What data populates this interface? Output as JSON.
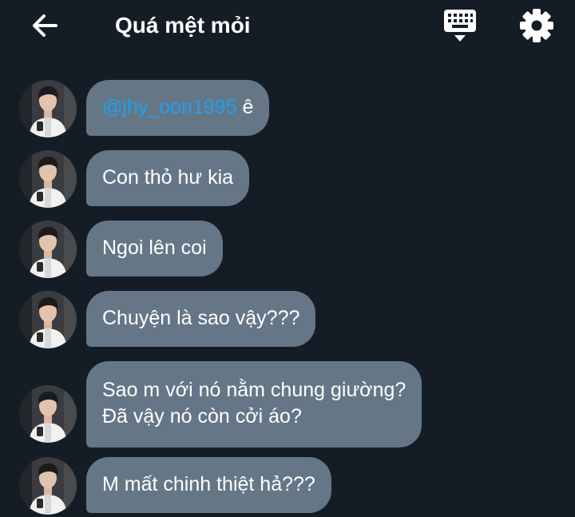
{
  "header": {
    "title": "Quá mệt mỏi",
    "back_icon": "arrow-left-icon",
    "keyboard_icon": "keyboard-icon",
    "settings_icon": "gear-icon"
  },
  "colors": {
    "background": "#141d26",
    "bubble": "#657786",
    "mention": "#1da1f2",
    "text": "#ffffff"
  },
  "messages": [
    {
      "mention": "@jhy_oon1995",
      "text": " ê"
    },
    {
      "text": "Con thỏ hư kia"
    },
    {
      "text": "Ngoi lên coi"
    },
    {
      "text": "Chuyện là sao vậy???"
    },
    {
      "line1": "Sao m với nó nằm chung giường?",
      "line2": "Đã vậy nó còn cởi áo?"
    },
    {
      "text": "M mất chinh thiệt hả???"
    }
  ]
}
